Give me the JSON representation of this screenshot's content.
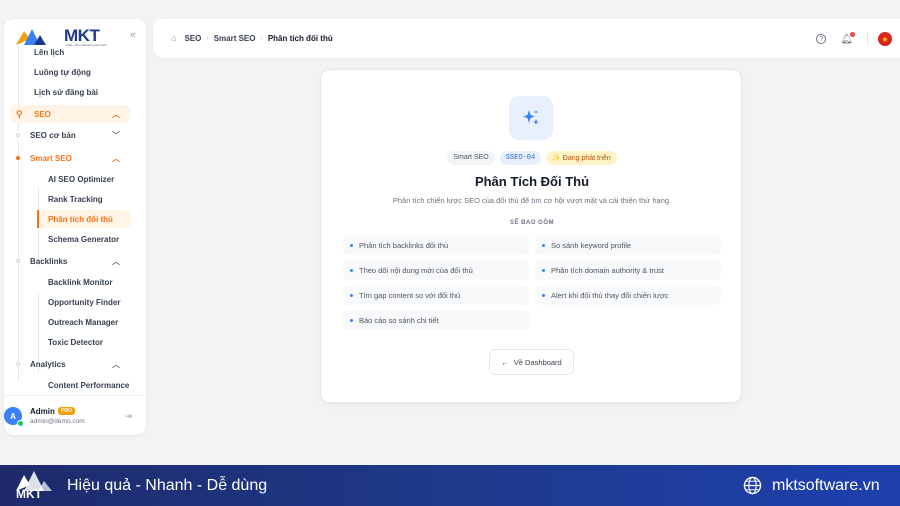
{
  "brand": {
    "name": "MKT",
    "tagline": "Phần mềm Marketing Đa Kênh"
  },
  "sidebar": {
    "collapse_icon": "«",
    "items": [
      {
        "label": "Lên lịch"
      },
      {
        "label": "Luồng tự động"
      },
      {
        "label": "Lịch sử đăng bài"
      },
      {
        "label": "SEO"
      },
      {
        "label": "SEO cơ bản"
      },
      {
        "label": "Smart SEO"
      },
      {
        "label": "AI SEO Optimizer"
      },
      {
        "label": "Rank Tracking"
      },
      {
        "label": "Phân tích đối thủ"
      },
      {
        "label": "Schema Generator"
      },
      {
        "label": "Backlinks"
      },
      {
        "label": "Backlink Monitor"
      },
      {
        "label": "Opportunity Finder"
      },
      {
        "label": "Outreach Manager"
      },
      {
        "label": "Toxic Detector"
      },
      {
        "label": "Analytics"
      },
      {
        "label": "Content Performance"
      }
    ],
    "user": {
      "initial": "A",
      "name": "Admin",
      "badge": "PRO",
      "email": "admin@demo.com"
    }
  },
  "topbar": {
    "breadcrumb": [
      "SEO",
      "Smart SEO",
      "Phân tích đối thủ"
    ]
  },
  "card": {
    "badges": {
      "category": "Smart SEO",
      "code": "SSEO-04",
      "status": "✨ Đang phát triển"
    },
    "title": "Phân Tích Đối Thủ",
    "description": "Phân tích chiến lược SEO của đối thủ để tìm cơ hội vượt mặt và cải thiện thứ hạng.",
    "includes_label": "SẼ BAO GỒM",
    "features": [
      "Phân tích backlinks đối thủ",
      "So sánh keyword profile",
      "Theo dõi nội dung mới của đối thủ",
      "Phân tích domain authority & trust",
      "Tìm gap content so với đối thủ",
      "Alert khi đối thủ thay đổi chiến lược",
      "Báo cáo so sánh chi tiết"
    ],
    "back_button": "Về Dashboard"
  },
  "footer": {
    "logo_text": "MKT",
    "slogan": "Hiệu quả - Nhanh - Dễ dùng",
    "website": "mktsoftware.vn"
  },
  "colors": {
    "accent": "#f97316",
    "primary": "#3b82f6",
    "footer_bg": "#1e3a8a"
  }
}
